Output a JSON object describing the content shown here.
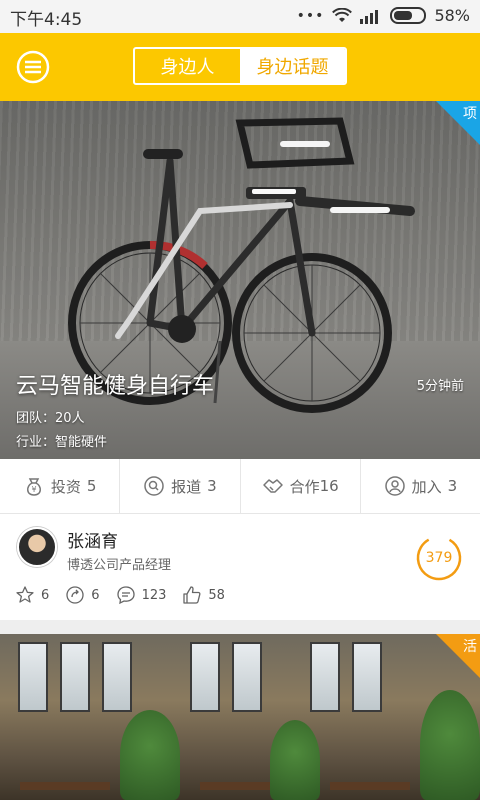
{
  "status_bar": {
    "time": "下午4:45",
    "battery": "58%"
  },
  "header": {
    "tabs": [
      {
        "label": "身边人",
        "active": false
      },
      {
        "label": "身边话题",
        "active": true
      }
    ],
    "accent_color": "#fcc800"
  },
  "feed": [
    {
      "tag": "项",
      "tag_color": "#1aa5e6",
      "title": "云马智能健身自行车",
      "time": "5分钟前",
      "team": "团队：20人",
      "industry": "行业：智能硬件",
      "actions": [
        {
          "icon": "money-bag-icon",
          "label": "投资",
          "count": "5"
        },
        {
          "icon": "search-report-icon",
          "label": "报道",
          "count": "3"
        },
        {
          "icon": "handshake-icon",
          "label": "合作",
          "count": "16"
        },
        {
          "icon": "user-add-icon",
          "label": "加入",
          "count": "3"
        }
      ],
      "author": {
        "name": "张涵育",
        "role": "博透公司产品经理",
        "score": "379"
      },
      "stats": {
        "stars": "6",
        "shares": "6",
        "comments": "123",
        "likes": "58"
      }
    },
    {
      "tag": "活",
      "tag_color": "#f39c12"
    }
  ]
}
